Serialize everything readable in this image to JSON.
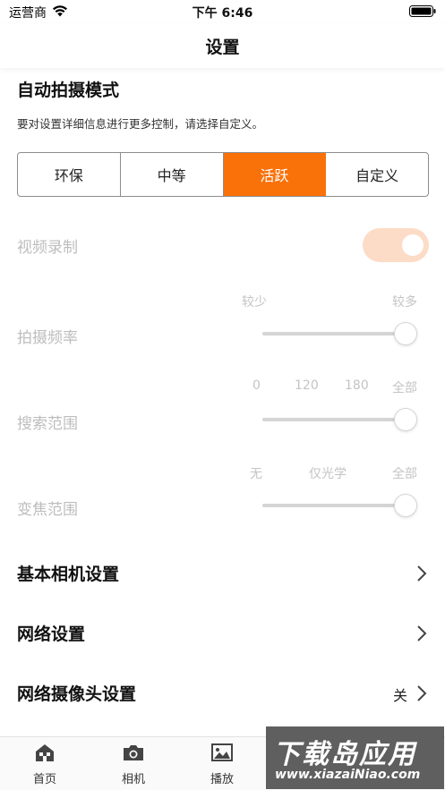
{
  "status_bar": {
    "carrier": "运营商",
    "time": "下午 6:46"
  },
  "nav": {
    "title": "设置"
  },
  "auto_mode": {
    "title": "自动拍摄模式",
    "description": "要对设置详细信息进行更多控制，请选择自定义。",
    "segments": [
      "环保",
      "中等",
      "活跃",
      "自定义"
    ],
    "selected_index": 2
  },
  "video": {
    "label": "视频录制",
    "enabled": true
  },
  "frequency": {
    "label": "拍摄频率",
    "ticks": [
      "较少",
      "较多"
    ],
    "value_fraction": 1.0
  },
  "search_range": {
    "label": "搜索范围",
    "ticks": [
      "0",
      "120",
      "180",
      "全部"
    ],
    "value_fraction": 1.0
  },
  "zoom_range": {
    "label": "变焦范围",
    "ticks": [
      "无",
      "仅光学",
      "全部"
    ],
    "value_fraction": 1.0
  },
  "menu": [
    {
      "label": "基本相机设置",
      "value": ""
    },
    {
      "label": "网络设置",
      "value": ""
    },
    {
      "label": "网络摄像头设置",
      "value": "关"
    }
  ],
  "tabs": [
    {
      "label": "首页",
      "icon": "home-icon"
    },
    {
      "label": "相机",
      "icon": "camera-icon"
    },
    {
      "label": "播放",
      "icon": "image-icon"
    }
  ],
  "watermark": {
    "title": "下载岛应用",
    "url": "www.xiazaiNiao.com"
  },
  "colors": {
    "accent": "#f97109",
    "toggle_disabled": "#fcdcc6",
    "disabled_text": "#bdbdbd"
  }
}
